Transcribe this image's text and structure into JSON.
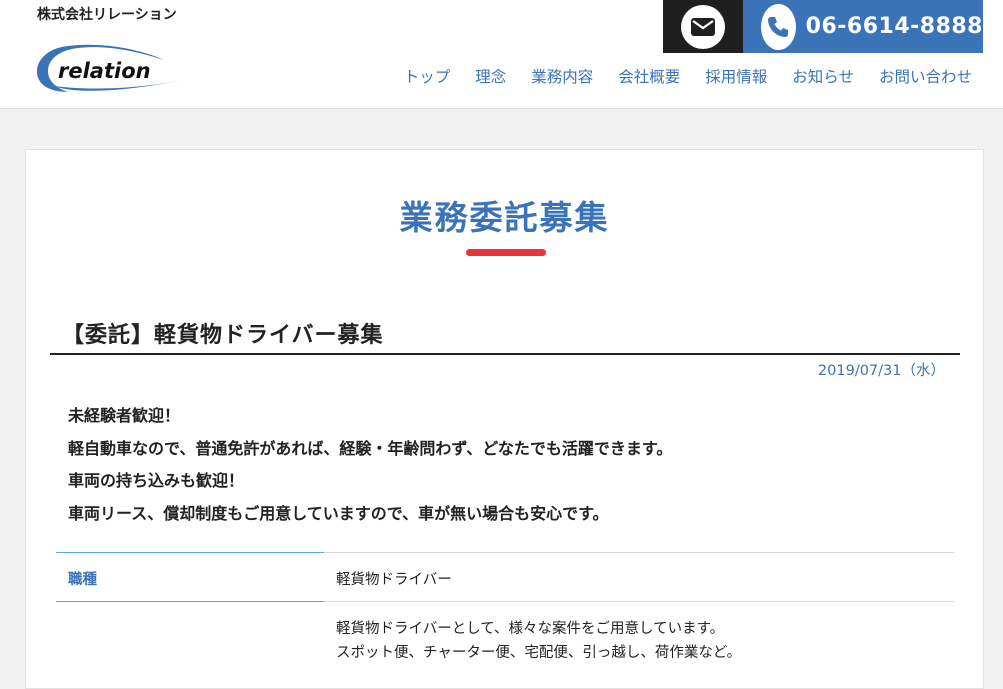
{
  "header": {
    "company_name": "株式会社リレーション",
    "logo_text": "relation",
    "phone": "06-6614-8888",
    "nav": [
      "トップ",
      "理念",
      "業務内容",
      "会社概要",
      "採用情報",
      "お知らせ",
      "お問い合わせ"
    ]
  },
  "main": {
    "page_title": "業務委託募集",
    "job_heading": "【委託】軽貨物ドライバー募集",
    "date": "2019/07/31（水）",
    "intro": [
      "未経験者歓迎！",
      "軽自動車なので、普通免許があれば、経験・年齢問わず、どなたでも活躍できます。",
      "車両の持ち込みも歓迎！",
      "車両リース、償却制度もご用意していますので、車が無い場合も安心です。"
    ],
    "table": [
      {
        "label": "職種",
        "lines": [
          "軽貨物ドライバー"
        ]
      },
      {
        "label": "",
        "lines": [
          "軽貨物ドライバーとして、様々な案件をご用意しています。",
          "スポット便、チャーター便、宅配便、引っ越し、荷作業など。"
        ]
      }
    ]
  },
  "colors": {
    "brand_blue": "#3b73b8",
    "accent_red": "#e8343b",
    "dark": "#1f1f1f"
  }
}
